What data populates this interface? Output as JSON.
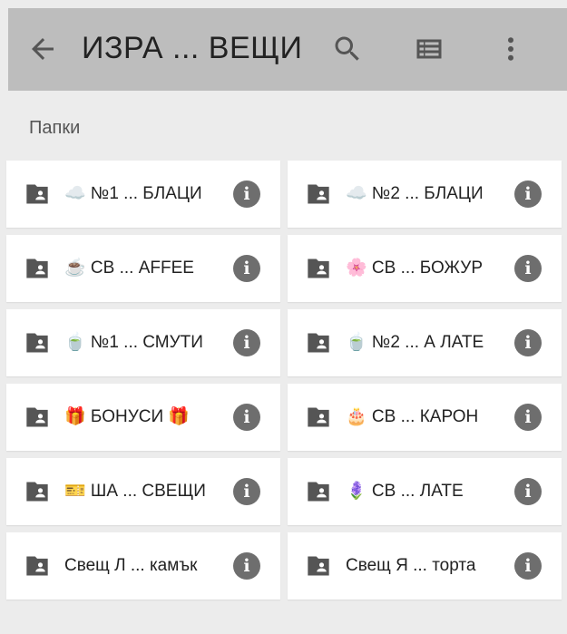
{
  "appbar": {
    "title": "ИЗРА ... ВЕЩИ",
    "back_icon": "arrow-back-icon",
    "search_icon": "search-icon",
    "view_icon": "view-list-icon",
    "more_icon": "more-vert-icon",
    "background": "#bdbdbd"
  },
  "section": {
    "label": "Папки"
  },
  "folders": [
    {
      "label": "☁️ №1 ... БЛАЦИ"
    },
    {
      "label": "☁️ №2 ... БЛАЦИ"
    },
    {
      "label": "☕ СВ ... AFFEE"
    },
    {
      "label": "🌸 СВ ... БОЖУР"
    },
    {
      "label": "🍵 №1 ... СМУТИ"
    },
    {
      "label": "🍵 №2 ... А ЛАТЕ"
    },
    {
      "label": "🎁 БОНУСИ 🎁"
    },
    {
      "label": "🎂 СВ ... КАРОН"
    },
    {
      "label": "🎫 ША ... СВЕЩИ"
    },
    {
      "label": "🪻 СВ ... ЛАТЕ"
    },
    {
      "label": "Свещ Л ... камък"
    },
    {
      "label": "Свещ Я ... торта"
    }
  ],
  "icons": {
    "folder": "shared-folder-icon",
    "info": "info-icon",
    "info_glyph": "i"
  }
}
